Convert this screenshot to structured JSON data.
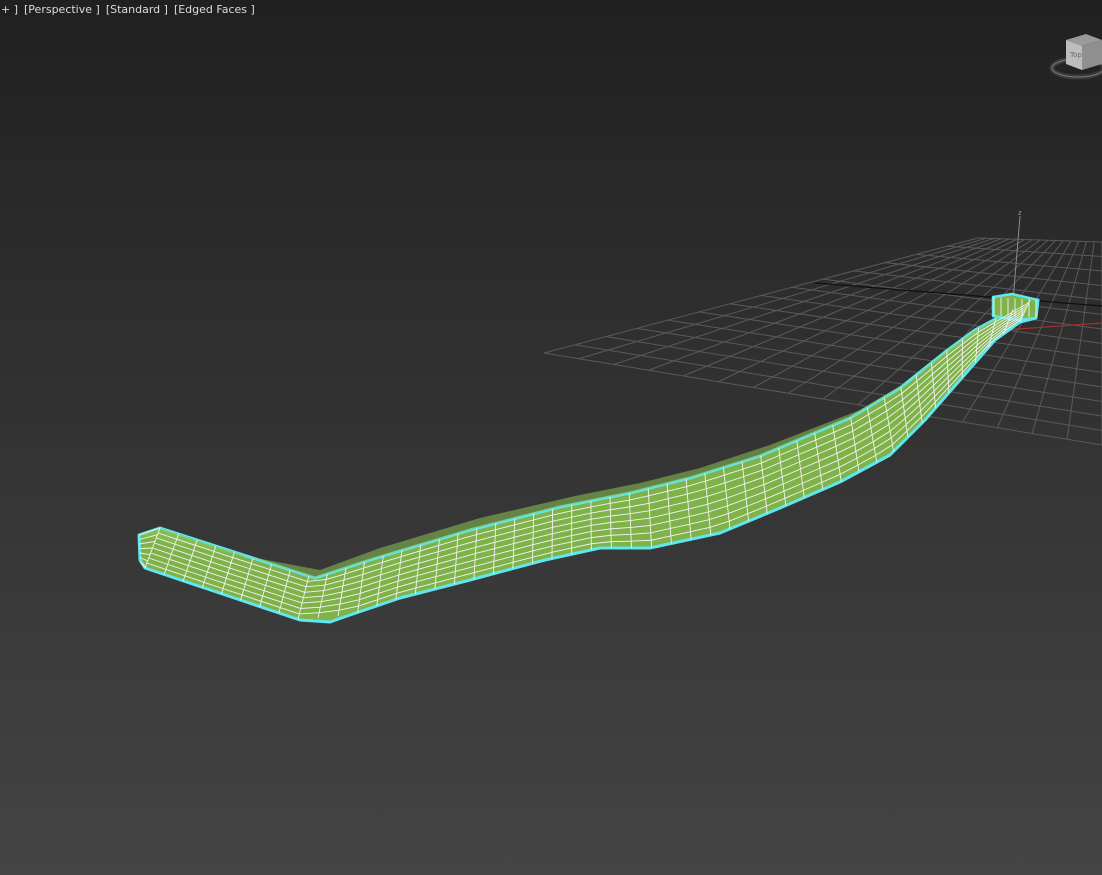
{
  "viewport": {
    "labels": {
      "menu": "+ ]",
      "view": "[Perspective ]",
      "shading": "[Standard ]",
      "display": "[Edged Faces ]"
    },
    "viewcube_face": "Top",
    "axis_label_z": "z"
  },
  "colors": {
    "background_top": "#202020",
    "background_bottom": "#444444",
    "grid_line": "#5a5a5a",
    "grid_axis_x": "#a03030",
    "grid_axis_y": "#101010",
    "mesh_fill": "#7fb34a",
    "mesh_edges": "#f2f2f2",
    "selection_outline": "#5ee7ef"
  }
}
